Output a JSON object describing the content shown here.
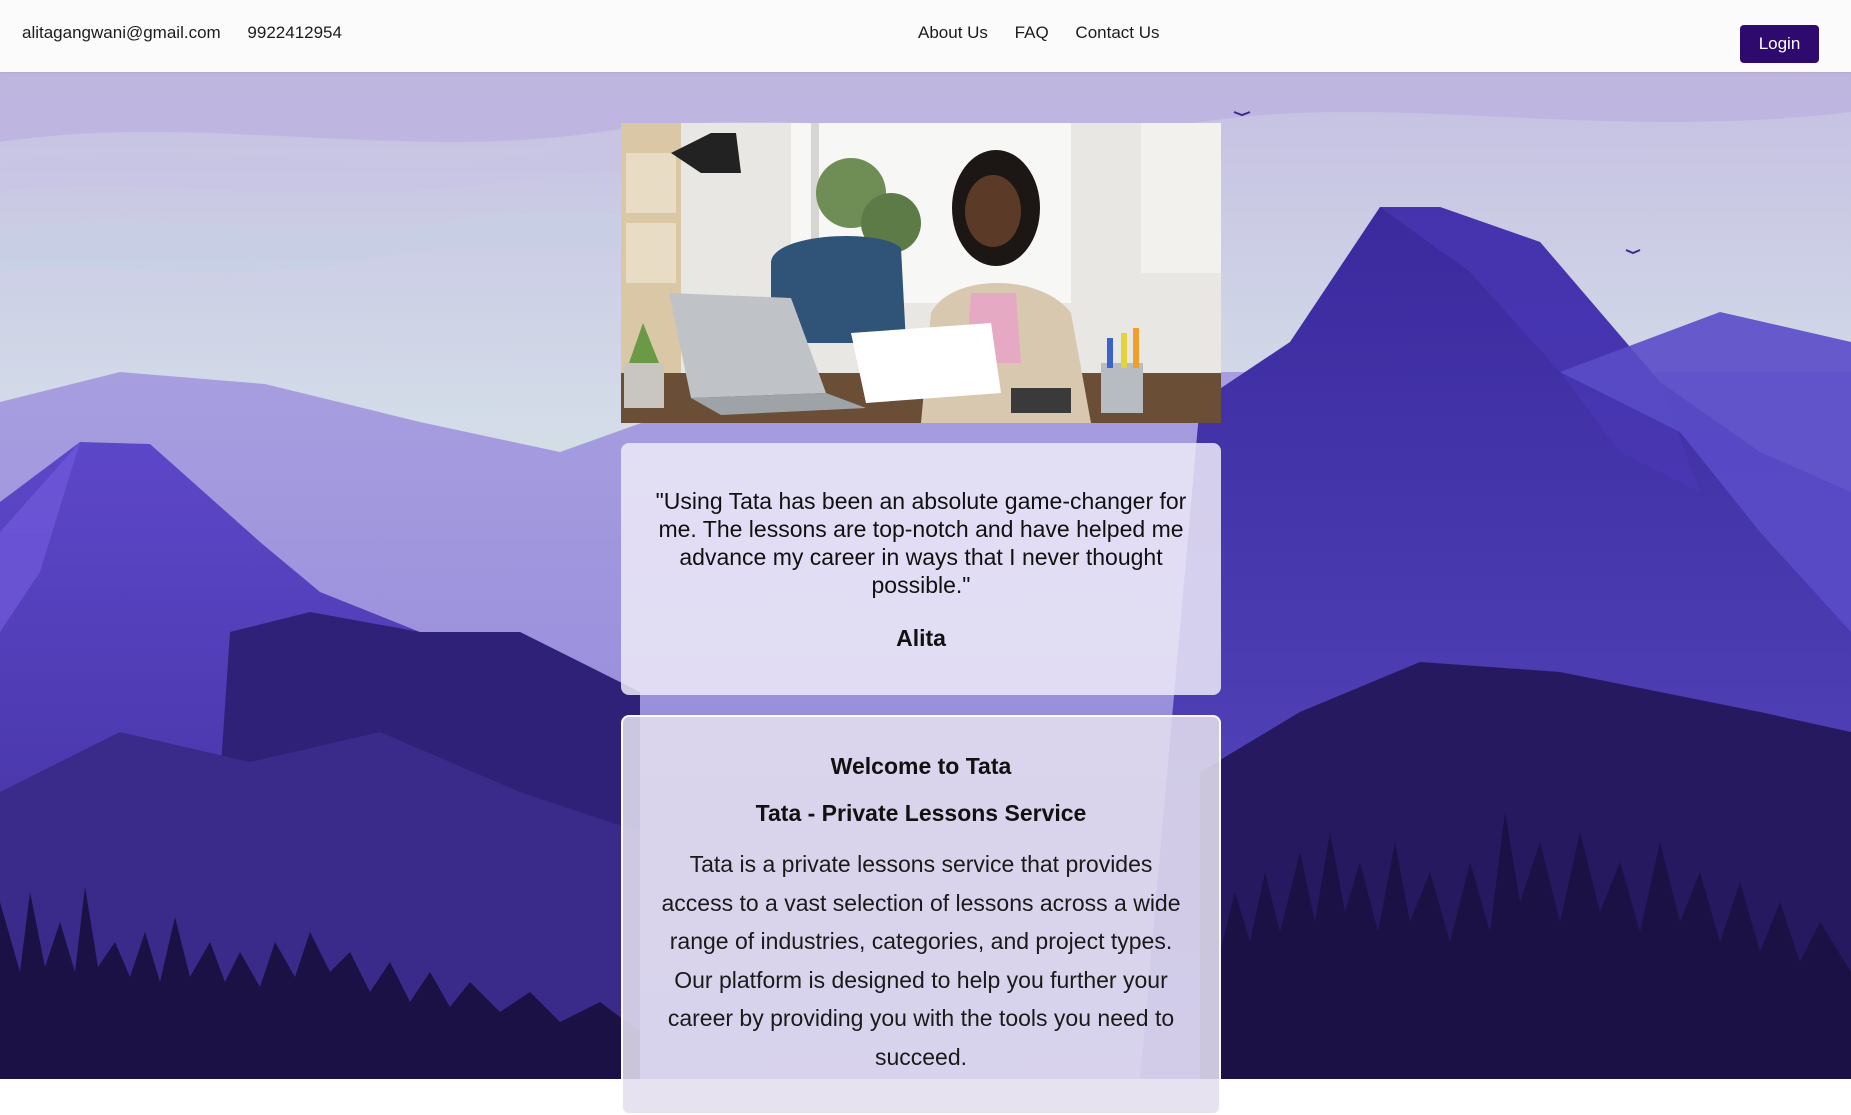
{
  "header": {
    "email": "alitagangwani@gmail.com",
    "phone": "9922412954",
    "nav": [
      "About Us",
      "FAQ",
      "Contact Us"
    ],
    "login_label": "Login"
  },
  "testimonial": {
    "quote": "\"Using Tata has been an absolute game-changer for me. The lessons are top-notch and have helped me advance my career in ways that I never thought possible.\"",
    "author": "Alita"
  },
  "welcome": {
    "title": "Welcome to Tata",
    "subtitle": "Tata - Private Lessons Service",
    "body": "Tata is a private lessons service that provides access to a vast selection of lessons across a wide range of industries, categories, and project types. Our platform is designed to help you further your career by providing you with the tools you need to succeed."
  },
  "colors": {
    "login_bg": "#2e0a6e",
    "mountain_dark": "#1f1450",
    "mountain_mid": "#3a2aa0",
    "mountain_light": "#6f5ad4",
    "sky_top": "#c9c4e4",
    "sky_bottom": "#d7e6c8"
  },
  "icons": {
    "hero_image": "woman-at-desk-with-laptop-photo",
    "background": "purple-mountain-landscape"
  }
}
